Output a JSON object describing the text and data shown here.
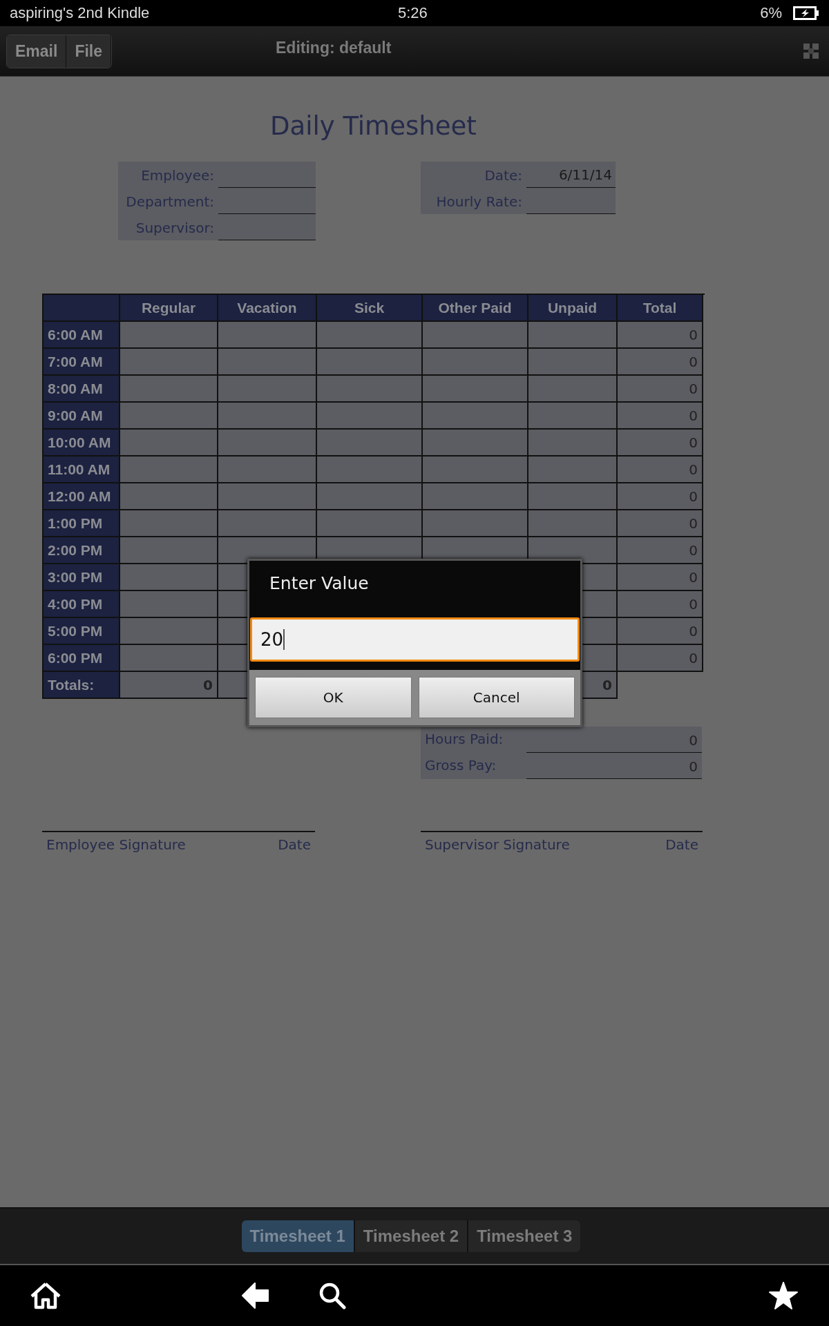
{
  "status_bar": {
    "device": "aspiring's 2nd Kindle",
    "time": "5:26",
    "battery": "6%"
  },
  "toolbar": {
    "buttons": [
      "Email",
      "File"
    ],
    "title": "Editing: default"
  },
  "form": {
    "title": "Daily Timesheet",
    "left_fields": [
      {
        "label": "Employee:"
      },
      {
        "label": "Department:"
      },
      {
        "label": "Supervisor:"
      }
    ],
    "right_fields": [
      {
        "label": "Date:",
        "value": "6/11/14"
      },
      {
        "label": "Hourly Rate:"
      }
    ]
  },
  "table": {
    "columns": [
      "Regular",
      "Vacation",
      "Sick",
      "Other Paid",
      "Unpaid",
      "Total"
    ],
    "rows": [
      {
        "time": "6:00 AM",
        "total": "0"
      },
      {
        "time": "7:00 AM",
        "total": "0"
      },
      {
        "time": "8:00 AM",
        "total": "0"
      },
      {
        "time": "9:00 AM",
        "total": "0"
      },
      {
        "time": "10:00 AM",
        "total": "0"
      },
      {
        "time": "11:00 AM",
        "total": "0"
      },
      {
        "time": "12:00 AM",
        "total": "0"
      },
      {
        "time": "1:00 PM",
        "total": "0"
      },
      {
        "time": "2:00 PM",
        "total": "0"
      },
      {
        "time": "3:00 PM",
        "total": "0"
      },
      {
        "time": "4:00 PM",
        "total": "0"
      },
      {
        "time": "5:00 PM",
        "total": "0"
      },
      {
        "time": "6:00 PM",
        "total": "0"
      }
    ],
    "totals": {
      "label": "Totals:",
      "regular": "0",
      "unpaid": "0"
    }
  },
  "summary": [
    {
      "label": "Hours Paid:",
      "value": "0"
    },
    {
      "label": "Gross Pay:",
      "value": "0"
    }
  ],
  "signatures": [
    {
      "label": "Employee Signature",
      "date": "Date"
    },
    {
      "label": "Supervisor Signature",
      "date": "Date"
    }
  ],
  "dialog": {
    "title": "Enter Value",
    "value": "20",
    "buttons": [
      "OK",
      "Cancel"
    ]
  },
  "sheet_tabs": [
    {
      "label": "Timesheet 1",
      "selected": true
    },
    {
      "label": "Timesheet 2",
      "selected": false
    },
    {
      "label": "Timesheet 3",
      "selected": false
    }
  ]
}
